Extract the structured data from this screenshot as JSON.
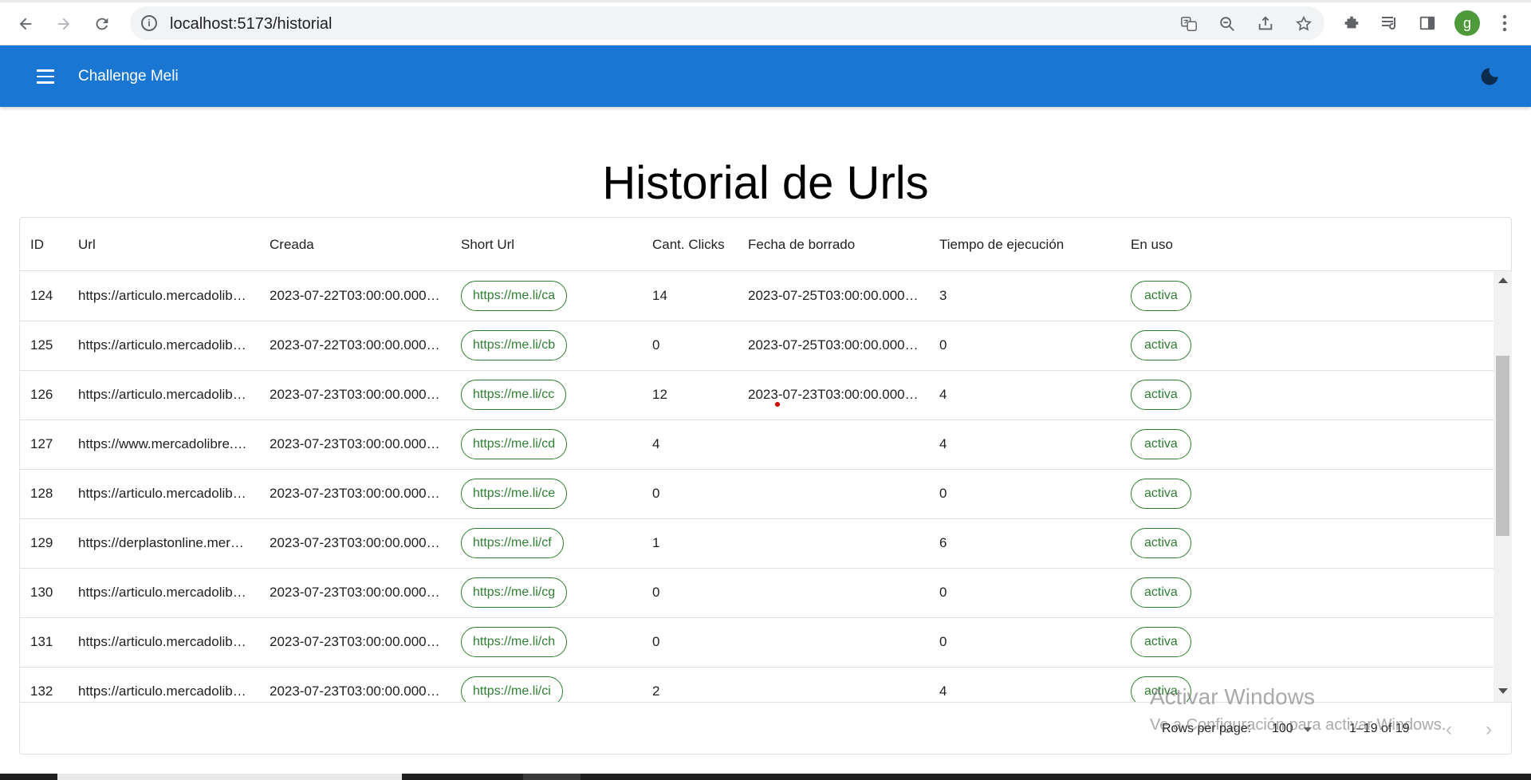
{
  "browser": {
    "url": "localhost:5173/historial",
    "info_icon": "i",
    "profile_initial": "g"
  },
  "app_bar": {
    "title": "Challenge Meli"
  },
  "page": {
    "title": "Historial de Urls"
  },
  "grid": {
    "columns": [
      "ID",
      "Url",
      "Creada",
      "Short Url",
      "Cant. Clicks",
      "Fecha de borrado",
      "Tiempo de ejecución",
      "En uso"
    ],
    "rows": [
      {
        "id": "124",
        "url": "https://articulo.mercadolib…",
        "created": "2023-07-22T03:00:00.000…",
        "short_url": "https://me.li/ca",
        "clicks": "14",
        "deleted_at": "2023-07-25T03:00:00.000…",
        "exec_time": "3",
        "status": "activa"
      },
      {
        "id": "125",
        "url": "https://articulo.mercadolib…",
        "created": "2023-07-22T03:00:00.000…",
        "short_url": "https://me.li/cb",
        "clicks": "0",
        "deleted_at": "2023-07-25T03:00:00.000…",
        "exec_time": "0",
        "status": "activa"
      },
      {
        "id": "126",
        "url": "https://articulo.mercadolib…",
        "created": "2023-07-23T03:00:00.000…",
        "short_url": "https://me.li/cc",
        "clicks": "12",
        "deleted_at": "2023-07-23T03:00:00.000…",
        "exec_time": "4",
        "status": "activa"
      },
      {
        "id": "127",
        "url": "https://www.mercadolibre.…",
        "created": "2023-07-23T03:00:00.000…",
        "short_url": "https://me.li/cd",
        "clicks": "4",
        "deleted_at": "",
        "exec_time": "4",
        "status": "activa"
      },
      {
        "id": "128",
        "url": "https://articulo.mercadolib…",
        "created": "2023-07-23T03:00:00.000…",
        "short_url": "https://me.li/ce",
        "clicks": "0",
        "deleted_at": "",
        "exec_time": "0",
        "status": "activa"
      },
      {
        "id": "129",
        "url": "https://derplastonline.mer…",
        "created": "2023-07-23T03:00:00.000…",
        "short_url": "https://me.li/cf",
        "clicks": "1",
        "deleted_at": "",
        "exec_time": "6",
        "status": "activa"
      },
      {
        "id": "130",
        "url": "https://articulo.mercadolib…",
        "created": "2023-07-23T03:00:00.000…",
        "short_url": "https://me.li/cg",
        "clicks": "0",
        "deleted_at": "",
        "exec_time": "0",
        "status": "activa"
      },
      {
        "id": "131",
        "url": "https://articulo.mercadolib…",
        "created": "2023-07-23T03:00:00.000…",
        "short_url": "https://me.li/ch",
        "clicks": "0",
        "deleted_at": "",
        "exec_time": "0",
        "status": "activa"
      },
      {
        "id": "132",
        "url": "https://articulo.mercadolib…",
        "created": "2023-07-23T03:00:00.000…",
        "short_url": "https://me.li/ci",
        "clicks": "2",
        "deleted_at": "",
        "exec_time": "4",
        "status": "activa"
      }
    ],
    "footer": {
      "rows_per_page_label": "Rows per page:",
      "rows_per_page_value": "100",
      "displayed_rows": "1–19 of 19"
    }
  },
  "watermark": {
    "title": "Activar Windows",
    "subtitle": "Ve a Configuración para activar Windows."
  },
  "colors": {
    "app_bar": "#1976d2",
    "chip_green": "#2e7d32"
  }
}
